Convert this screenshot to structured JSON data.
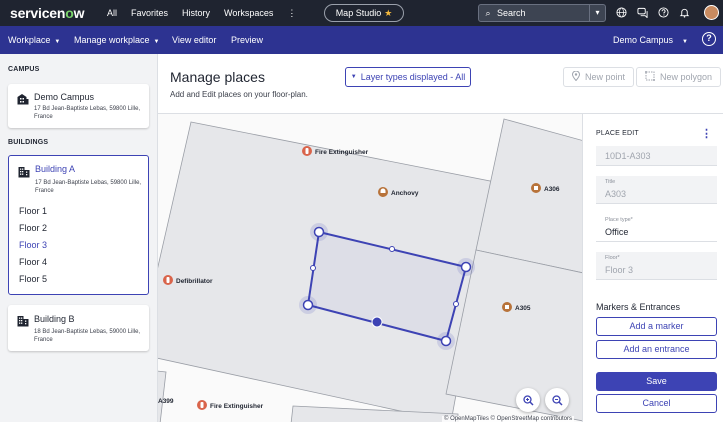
{
  "topbar": {
    "logo_prefix": "servicen",
    "logo_o": "o",
    "logo_suffix": "w",
    "nav": [
      "All",
      "Favorites",
      "History",
      "Workspaces"
    ],
    "studio_label": "Map Studio",
    "search_placeholder": "Search",
    "icons": [
      "globe-icon",
      "chat-icon",
      "help-icon",
      "bell-icon"
    ]
  },
  "subbar": {
    "workplace": "Workplace",
    "manage_workplace": "Manage workplace",
    "view_editor": "View editor",
    "preview": "Preview",
    "campus_select": "Demo Campus"
  },
  "sidebar": {
    "campus_heading": "CAMPUS",
    "campus": {
      "name": "Demo Campus",
      "address": "17 Bd Jean-Baptiste Lebas, 59800 Lille, France"
    },
    "buildings_heading": "BUILDINGS",
    "buildings": [
      {
        "name": "Building A",
        "address": "17 Bd Jean-Baptiste Lebas, 59800 Lille, France",
        "floors": [
          "Floor 1",
          "Floor 2",
          "Floor 3",
          "Floor 4",
          "Floor 5"
        ],
        "active_floor": "Floor 3"
      },
      {
        "name": "Building B",
        "address": "18 Bd Jean-Baptiste Lebas, 59000 Lille, France"
      }
    ]
  },
  "main": {
    "title": "Manage places",
    "subtitle": "Add and Edit places on your floor-plan.",
    "layer_button": "Layer types displayed - All",
    "new_point": "New point",
    "new_polygon": "New polygon"
  },
  "map": {
    "labels": {
      "fire1": "Fire Extinguisher",
      "anchovy": "Anchovy",
      "a306": "A306",
      "defib": "Defibrillator",
      "a305": "A305",
      "a399": "A399",
      "fire2": "Fire Extinguisher"
    },
    "attribution": "© OpenMapTiles © OpenStreetMap contributors",
    "colors": {
      "room_fill": "#e6e7ea",
      "room_stroke": "#9a9ea6",
      "selection": "#3d43b4",
      "poi_red": "#d9644b",
      "poi_brown": "#b8733a"
    }
  },
  "panel": {
    "heading": "PLACE EDIT",
    "code_value": "10D1-A303",
    "title_label": "Title",
    "title_value": "A303",
    "type_label": "Place type*",
    "type_value": "Office",
    "floor_label": "Floor*",
    "floor_value": "Floor 3",
    "markers_heading": "Markers & Entrances",
    "add_marker": "Add a marker",
    "add_entrance": "Add an entrance",
    "save": "Save",
    "cancel": "Cancel"
  }
}
